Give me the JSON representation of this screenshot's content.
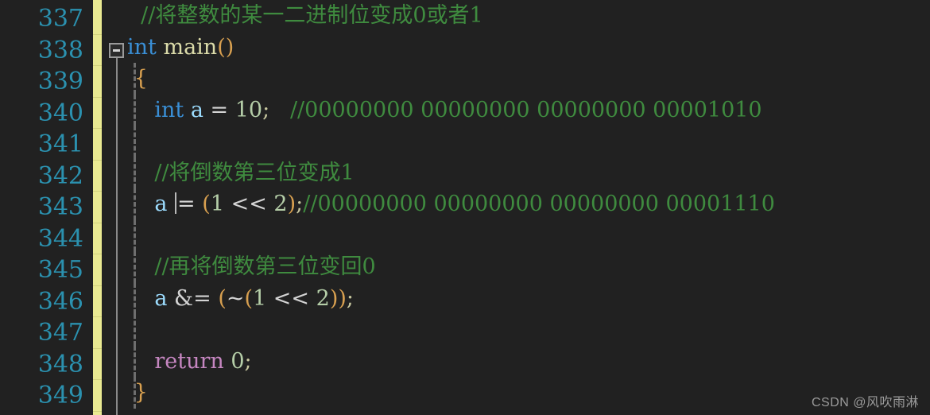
{
  "editor": {
    "background_color": "#212121",
    "line_number_color": "#2b91af",
    "change_bar_color": "#eaea92",
    "comment_color": "#3f8b3f",
    "keyword_color": "#3a8fd6",
    "control_keyword_color": "#c586c0",
    "function_color": "#dcdcaa",
    "variable_color": "#9cdcfe",
    "number_color": "#b5cea8",
    "first_line": 337,
    "last_line": 349
  },
  "line_numbers": [
    "337",
    "338",
    "339",
    "340",
    "341",
    "342",
    "343",
    "344",
    "345",
    "346",
    "347",
    "348",
    "349"
  ],
  "fold": {
    "marker": "collapse-minus",
    "line": "338"
  },
  "code_lines": [
    {
      "number": "337",
      "text": "  //将整数的某一二进制位变成0或者1",
      "tokens": [
        {
          "t": "  ",
          "c": "c-plain"
        },
        {
          "t": "//将整数的某一二进制位变成0或者1",
          "c": "c-comment"
        }
      ]
    },
    {
      "number": "338",
      "text": "int main()",
      "tokens": [
        {
          "t": "int",
          "c": "c-keyword"
        },
        {
          "t": " ",
          "c": "c-plain"
        },
        {
          "t": "main",
          "c": "c-func"
        },
        {
          "t": "()",
          "c": "c-brace"
        }
      ]
    },
    {
      "number": "339",
      "text": " {",
      "tokens": [
        {
          "t": " ",
          "c": "c-plain"
        },
        {
          "t": "{",
          "c": "c-brace"
        }
      ]
    },
    {
      "number": "340",
      "text": "    int a = 10;   //00000000 00000000 00000000 00001010",
      "tokens": [
        {
          "t": "    ",
          "c": "c-plain"
        },
        {
          "t": "int",
          "c": "c-keyword"
        },
        {
          "t": " ",
          "c": "c-plain"
        },
        {
          "t": "a",
          "c": "c-var"
        },
        {
          "t": " ",
          "c": "c-plain"
        },
        {
          "t": "=",
          "c": "c-op"
        },
        {
          "t": " ",
          "c": "c-plain"
        },
        {
          "t": "10",
          "c": "c-num"
        },
        {
          "t": ";",
          "c": "c-punct"
        },
        {
          "t": "   ",
          "c": "c-plain"
        },
        {
          "t": "//00000000 00000000 00000000 00001010",
          "c": "c-comment"
        }
      ]
    },
    {
      "number": "341",
      "text": "",
      "tokens": []
    },
    {
      "number": "342",
      "text": "    //将倒数第三位变成1",
      "tokens": [
        {
          "t": "    ",
          "c": "c-plain"
        },
        {
          "t": "//将倒数第三位变成1",
          "c": "c-comment"
        }
      ]
    },
    {
      "number": "343",
      "text": "    a |= (1 << 2);//00000000 00000000 00000000 00001110",
      "tokens": [
        {
          "t": "    ",
          "c": "c-plain"
        },
        {
          "t": "a",
          "c": "c-var"
        },
        {
          "t": " ",
          "c": "c-plain"
        },
        {
          "t": "CARET",
          "c": "caret-slot"
        },
        {
          "t": "= ",
          "c": "c-op"
        },
        {
          "t": "(",
          "c": "c-brace"
        },
        {
          "t": "1",
          "c": "c-num"
        },
        {
          "t": " << ",
          "c": "c-op"
        },
        {
          "t": "2",
          "c": "c-num"
        },
        {
          "t": ")",
          "c": "c-brace"
        },
        {
          "t": ";",
          "c": "c-punct"
        },
        {
          "t": "//00000000 00000000 00000000 00001110",
          "c": "c-comment"
        }
      ]
    },
    {
      "number": "344",
      "text": "",
      "tokens": []
    },
    {
      "number": "345",
      "text": "    //再将倒数第三位变回0",
      "tokens": [
        {
          "t": "    ",
          "c": "c-plain"
        },
        {
          "t": "//再将倒数第三位变回0",
          "c": "c-comment"
        }
      ]
    },
    {
      "number": "346",
      "text": "    a &= (~(1 << 2));",
      "tokens": [
        {
          "t": "    ",
          "c": "c-plain"
        },
        {
          "t": "a",
          "c": "c-var"
        },
        {
          "t": " ",
          "c": "c-plain"
        },
        {
          "t": "&=",
          "c": "c-op"
        },
        {
          "t": " ",
          "c": "c-plain"
        },
        {
          "t": "(",
          "c": "c-brace"
        },
        {
          "t": "~",
          "c": "c-op"
        },
        {
          "t": "(",
          "c": "c-brace"
        },
        {
          "t": "1",
          "c": "c-num"
        },
        {
          "t": " << ",
          "c": "c-op"
        },
        {
          "t": "2",
          "c": "c-num"
        },
        {
          "t": "))",
          "c": "c-brace"
        },
        {
          "t": ";",
          "c": "c-punct"
        }
      ]
    },
    {
      "number": "347",
      "text": "",
      "tokens": []
    },
    {
      "number": "348",
      "text": "    return 0;",
      "tokens": [
        {
          "t": "    ",
          "c": "c-plain"
        },
        {
          "t": "return",
          "c": "c-ctrl"
        },
        {
          "t": " ",
          "c": "c-plain"
        },
        {
          "t": "0",
          "c": "c-num"
        },
        {
          "t": ";",
          "c": "c-punct"
        }
      ]
    },
    {
      "number": "349",
      "text": " }",
      "tokens": [
        {
          "t": " ",
          "c": "c-plain"
        },
        {
          "t": "}",
          "c": "c-brace"
        }
      ]
    }
  ],
  "watermark": {
    "text": "CSDN @风吹雨淋"
  }
}
